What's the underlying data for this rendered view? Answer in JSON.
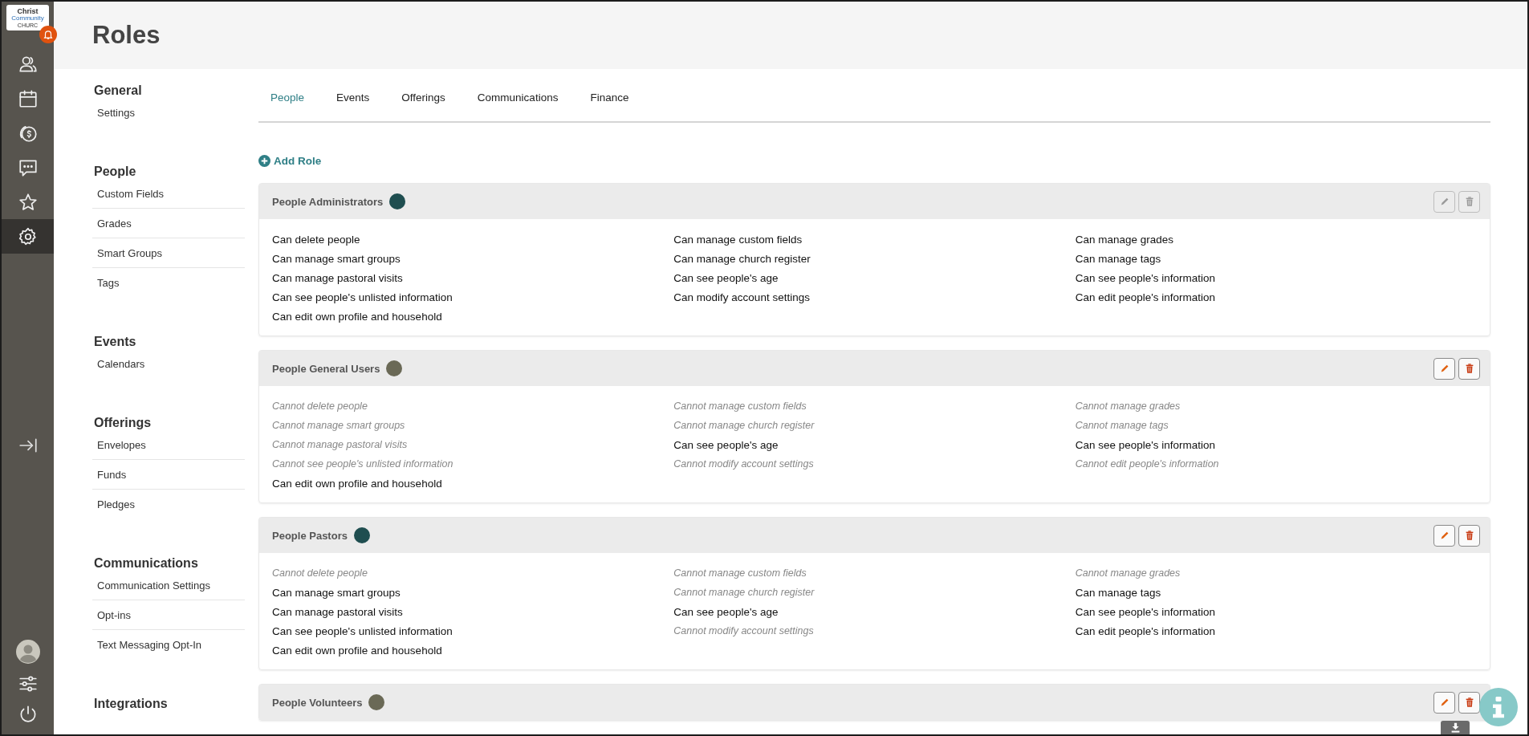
{
  "logo": {
    "line1": "Christ",
    "line2": "Community",
    "line3": "CHURC"
  },
  "rail": [
    {
      "kind": "people",
      "selected": false
    },
    {
      "kind": "calendar",
      "selected": false
    },
    {
      "kind": "giving",
      "selected": false
    },
    {
      "kind": "messages",
      "selected": false
    },
    {
      "kind": "star",
      "selected": false
    },
    {
      "kind": "settings",
      "selected": true
    }
  ],
  "page_title": "Roles",
  "sidebar": [
    {
      "heading": "General",
      "items": [
        "Settings"
      ]
    },
    {
      "heading": "People",
      "items": [
        "Custom Fields",
        "Grades",
        "Smart Groups",
        "Tags"
      ]
    },
    {
      "heading": "Events",
      "items": [
        "Calendars"
      ]
    },
    {
      "heading": "Offerings",
      "items": [
        "Envelopes",
        "Funds",
        "Pledges"
      ]
    },
    {
      "heading": "Communications",
      "items": [
        "Communication Settings",
        "Opt-ins",
        "Text Messaging Opt-In"
      ]
    },
    {
      "heading": "Integrations"
    }
  ],
  "tabs": [
    {
      "label": "People",
      "selected": true
    },
    {
      "label": "Events",
      "selected": false
    },
    {
      "label": "Offerings",
      "selected": false
    },
    {
      "label": "Communications",
      "selected": false
    },
    {
      "label": "Finance",
      "selected": false
    }
  ],
  "add_role": "Add Role",
  "roles": [
    {
      "name": "People Administrators",
      "color": "#1f4e50",
      "disabled": true,
      "permissions": [
        {
          "text": "Can delete people",
          "allowed": true
        },
        {
          "text": "Can manage custom fields",
          "allowed": true
        },
        {
          "text": "Can manage grades",
          "allowed": true
        },
        {
          "text": "Can manage smart groups",
          "allowed": true
        },
        {
          "text": "Can manage church register",
          "allowed": true
        },
        {
          "text": "Can manage tags",
          "allowed": true
        },
        {
          "text": "Can manage pastoral visits",
          "allowed": true
        },
        {
          "text": "Can see people's age",
          "allowed": true
        },
        {
          "text": "Can see people's information",
          "allowed": true
        },
        {
          "text": "Can see people's unlisted information",
          "allowed": true
        },
        {
          "text": "Can modify account settings",
          "allowed": true
        },
        {
          "text": "Can edit people's information",
          "allowed": true
        },
        {
          "text": "Can edit own profile and household",
          "allowed": true
        }
      ]
    },
    {
      "name": "People General Users",
      "color": "#6a6956",
      "disabled": false,
      "permissions": [
        {
          "text": "Cannot delete people",
          "allowed": false
        },
        {
          "text": "Cannot manage custom fields",
          "allowed": false
        },
        {
          "text": "Cannot manage grades",
          "allowed": false
        },
        {
          "text": "Cannot manage smart groups",
          "allowed": false
        },
        {
          "text": "Cannot manage church register",
          "allowed": false
        },
        {
          "text": "Cannot manage tags",
          "allowed": false
        },
        {
          "text": "Cannot manage pastoral visits",
          "allowed": false
        },
        {
          "text": "Can see people's age",
          "allowed": true
        },
        {
          "text": "Can see people's information",
          "allowed": true
        },
        {
          "text": "Cannot see people's unlisted information",
          "allowed": false
        },
        {
          "text": "Cannot modify account settings",
          "allowed": false
        },
        {
          "text": "Cannot edit people's information",
          "allowed": false
        },
        {
          "text": "Can edit own profile and household",
          "allowed": true
        }
      ]
    },
    {
      "name": "People Pastors",
      "color": "#1f4e50",
      "disabled": false,
      "permissions": [
        {
          "text": "Cannot delete people",
          "allowed": false
        },
        {
          "text": "Cannot manage custom fields",
          "allowed": false
        },
        {
          "text": "Cannot manage grades",
          "allowed": false
        },
        {
          "text": "Can manage smart groups",
          "allowed": true
        },
        {
          "text": "Cannot manage church register",
          "allowed": false
        },
        {
          "text": "Can manage tags",
          "allowed": true
        },
        {
          "text": "Can manage pastoral visits",
          "allowed": true
        },
        {
          "text": "Can see people's age",
          "allowed": true
        },
        {
          "text": "Can see people's information",
          "allowed": true
        },
        {
          "text": "Can see people's unlisted information",
          "allowed": true
        },
        {
          "text": "Cannot modify account settings",
          "allowed": false
        },
        {
          "text": "Can edit people's information",
          "allowed": true
        },
        {
          "text": "Can edit own profile and household",
          "allowed": true
        }
      ]
    },
    {
      "name": "People Volunteers",
      "color": "#6a6956",
      "disabled": false
    }
  ]
}
